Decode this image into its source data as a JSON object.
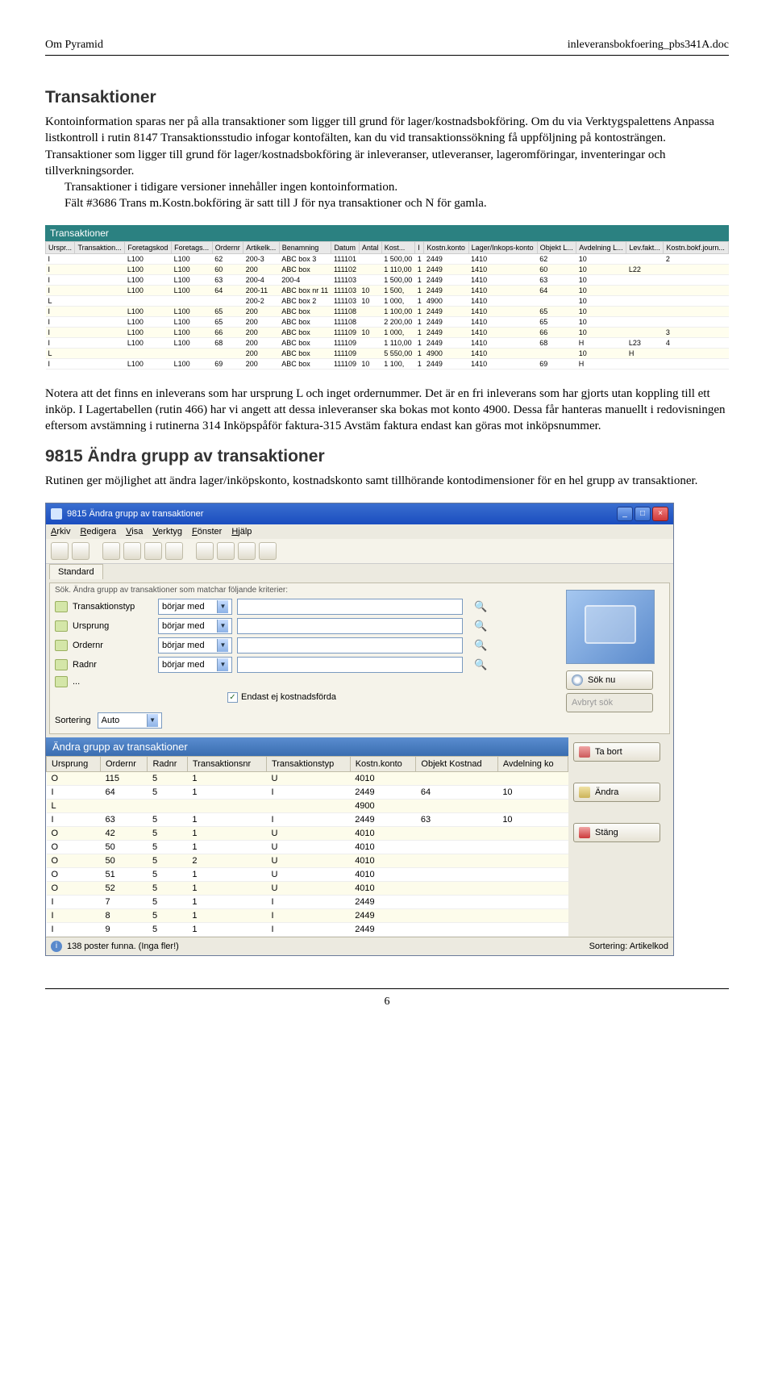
{
  "header": {
    "left": "Om Pyramid",
    "right": "inleveransbokfoering_pbs341A.doc"
  },
  "h1": "Transaktioner",
  "p1": "Kontoinformation sparas ner på alla transaktioner som ligger till grund för lager/kostnadsbokföring. Om du via Verktygspalettens Anpassa listkontroll i rutin 8147 Transaktionsstudio infogar kontofälten, kan du vid transaktionssökning få uppföljning på kontosträngen. Transaktioner som ligger till grund för lager/kostnadsbokföring är inleveranser, utleveranser, lageromföringar, inventeringar och tillverkningsorder.",
  "p1b": "Transaktioner i tidigare versioner innehåller ingen kontoinformation.",
  "p1c": "Fält #3686 Trans m.Kostn.bokföring är satt till J för nya transaktioner och N för gamla.",
  "shot1": {
    "title": "Transaktioner",
    "cols": [
      "Urspr...",
      "Transaktion...",
      "Foretagskod",
      "Foretags...",
      "Ordernr",
      "Artikelk...",
      "Benamning",
      "Datum",
      "Antal",
      "Kost...",
      "I",
      "Kostn.konto",
      "Lager/Inkops-konto",
      "Objekt L...",
      "Avdelning L...",
      "Lev.fakt...",
      "Kostn.bokf.journ..."
    ],
    "rows": [
      [
        "I",
        "",
        "L100",
        "L100",
        "62",
        "200-3",
        "ABC box 3",
        "111101",
        "",
        "1 500,00",
        "1",
        "2449",
        "1410",
        "62",
        "10",
        "",
        "2"
      ],
      [
        "I",
        "",
        "L100",
        "L100",
        "60",
        "200",
        "ABC box",
        "111102",
        "",
        "1 110,00",
        "1",
        "2449",
        "1410",
        "60",
        "10",
        "L22",
        ""
      ],
      [
        "I",
        "",
        "L100",
        "L100",
        "63",
        "200-4",
        "200-4",
        "111103",
        "",
        "1 500,00",
        "1",
        "2449",
        "1410",
        "63",
        "10",
        "",
        ""
      ],
      [
        "I",
        "",
        "L100",
        "L100",
        "64",
        "200-11",
        "ABC box nr 11",
        "111103",
        "10",
        "1 500,",
        "1",
        "2449",
        "1410",
        "64",
        "10",
        "",
        ""
      ],
      [
        "L",
        "",
        "",
        "",
        "",
        "200-2",
        "ABC box 2",
        "111103",
        "10",
        "1 000,",
        "1",
        "4900",
        "1410",
        "",
        "10",
        "",
        ""
      ],
      [
        "I",
        "",
        "L100",
        "L100",
        "65",
        "200",
        "ABC box",
        "111108",
        "",
        "1 100,00",
        "1",
        "2449",
        "1410",
        "65",
        "10",
        "",
        ""
      ],
      [
        "I",
        "",
        "L100",
        "L100",
        "65",
        "200",
        "ABC box",
        "111108",
        "",
        "2 200,00",
        "1",
        "2449",
        "1410",
        "65",
        "10",
        "",
        ""
      ],
      [
        "I",
        "",
        "L100",
        "L100",
        "66",
        "200",
        "ABC box",
        "111109",
        "10",
        "1 000,",
        "1",
        "2449",
        "1410",
        "66",
        "10",
        "",
        "3"
      ],
      [
        "I",
        "",
        "L100",
        "L100",
        "68",
        "200",
        "ABC box",
        "111109",
        "",
        "1 110,00",
        "1",
        "2449",
        "1410",
        "68",
        "H",
        "L23",
        "4"
      ],
      [
        "L",
        "",
        "",
        "",
        "",
        "200",
        "ABC box",
        "111109",
        "",
        "5 550,00",
        "1",
        "4900",
        "1410",
        "",
        "10",
        "H",
        ""
      ],
      [
        "I",
        "",
        "L100",
        "L100",
        "69",
        "200",
        "ABC box",
        "111109",
        "10",
        "1 100,",
        "1",
        "2449",
        "1410",
        "69",
        "H",
        "",
        ""
      ]
    ]
  },
  "p2": "Notera att det finns en inleverans som har ursprung L och inget ordernummer. Det är en fri inleverans som har gjorts utan koppling till ett inköp. I Lagertabellen (rutin 466) har vi angett att dessa inleveranser ska bokas mot konto 4900. Dessa får hanteras manuellt i redovisningen eftersom avstämning i rutinerna 314 Inköpspåför faktura-315 Avstäm faktura endast kan göras mot inköpsnummer.",
  "h2": "9815 Ändra grupp av transaktioner",
  "p3": "Rutinen ger möjlighet att ändra lager/inköpskonto, kostnadskonto samt tillhörande kontodimensioner för en hel grupp av transaktioner.",
  "dlg": {
    "title": "9815 Ändra grupp av transaktioner",
    "menu": [
      "Arkiv",
      "Redigera",
      "Visa",
      "Verktyg",
      "Fönster",
      "Hjälp"
    ],
    "tab": "Standard",
    "search_head": "Sök. Ändra grupp av transaktioner som matchar följande kriterier:",
    "fields": [
      {
        "label": "Transaktionstyp",
        "op": "börjar med"
      },
      {
        "label": "Ursprung",
        "op": "börjar med"
      },
      {
        "label": "Ordernr",
        "op": "börjar med"
      },
      {
        "label": "Radnr",
        "op": "börjar med"
      },
      {
        "label": "...",
        "op": ""
      }
    ],
    "checkbox": "Endast ej kostnadsförda",
    "sort_label": "Sortering",
    "sort_value": "Auto",
    "btn_sok": "Sök nu",
    "btn_avbryt": "Avbryt sök",
    "grid_title": "Ändra grupp av transaktioner",
    "grid_cols": [
      "Ursprung",
      "Ordernr",
      "Radnr",
      "Transaktionsnr",
      "Transaktionstyp",
      "Kostn.konto",
      "Objekt Kostnad",
      "Avdelning ko"
    ],
    "grid_rows": [
      [
        "O",
        "115",
        "5",
        "1",
        "U",
        "4010",
        "",
        ""
      ],
      [
        "I",
        "64",
        "5",
        "1",
        "I",
        "2449",
        "64",
        "10"
      ],
      [
        "L",
        "",
        "",
        "",
        "",
        "4900",
        "",
        ""
      ],
      [
        "I",
        "63",
        "5",
        "1",
        "I",
        "2449",
        "63",
        "10"
      ],
      [
        "O",
        "42",
        "5",
        "1",
        "U",
        "4010",
        "",
        ""
      ],
      [
        "O",
        "50",
        "5",
        "1",
        "U",
        "4010",
        "",
        ""
      ],
      [
        "O",
        "50",
        "5",
        "2",
        "U",
        "4010",
        "",
        ""
      ],
      [
        "O",
        "51",
        "5",
        "1",
        "U",
        "4010",
        "",
        ""
      ],
      [
        "O",
        "52",
        "5",
        "1",
        "U",
        "4010",
        "",
        ""
      ],
      [
        "I",
        "7",
        "5",
        "1",
        "I",
        "2449",
        "",
        ""
      ],
      [
        "I",
        "8",
        "5",
        "1",
        "I",
        "2449",
        "",
        ""
      ],
      [
        "I",
        "9",
        "5",
        "1",
        "I",
        "2449",
        "",
        ""
      ]
    ],
    "btn_tabort": "Ta bort",
    "btn_andra": "Ändra",
    "btn_stang": "Stäng",
    "status_text": "138 poster funna. (Inga fler!)",
    "status_sort": "Sortering: Artikelkod"
  },
  "page_no": "6"
}
